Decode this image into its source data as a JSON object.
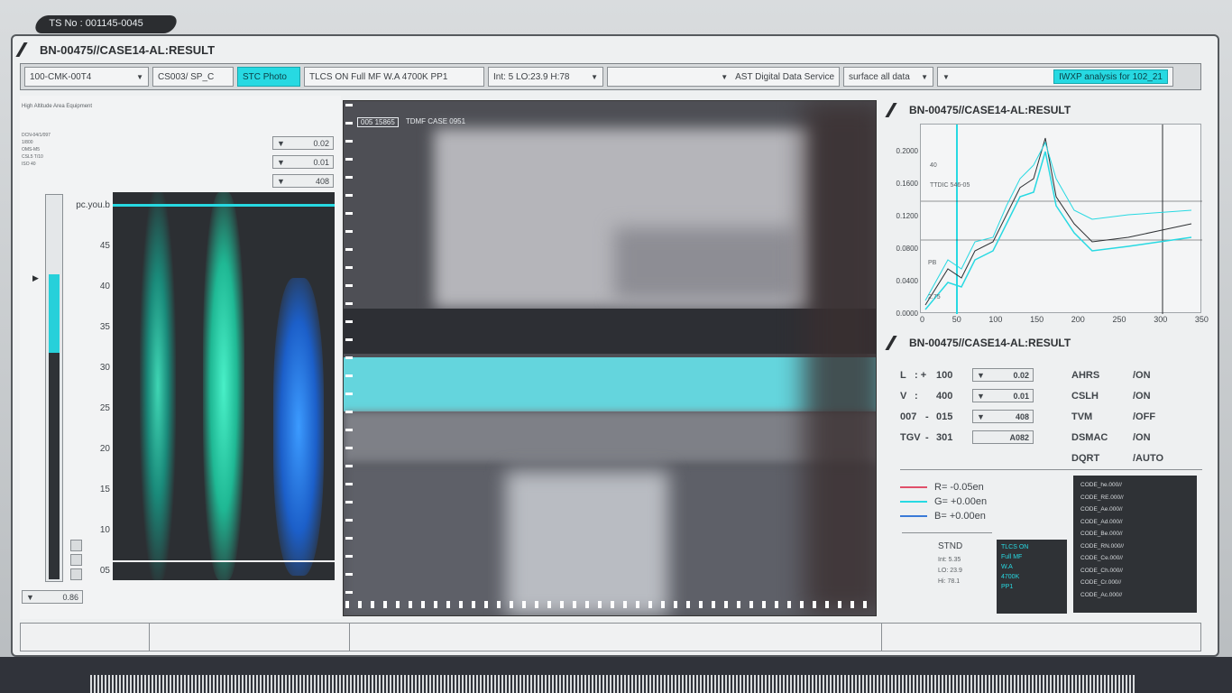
{
  "ts_no": "TS No : 001145-0045",
  "window_title": "BN-00475//CASE14-AL:RESULT",
  "toolbar": {
    "mode": "100-CMK-00T4",
    "code": "CS003/ SP_C",
    "photo_btn": "STC Photo",
    "tlcs": "TLCS ON  Full MF  W.A 4700K PP1",
    "int": "Int: 5 LO:23.9 H:78",
    "blank": "",
    "service": "AST Digital Data Service",
    "surface": "surface all data",
    "blank2": "",
    "analysis": "IWXP analysis for 102_21"
  },
  "left": {
    "header": "High Altitude Area Equipment",
    "info_lines": [
      "DCN-04/1/097",
      "1/800",
      "OMS-M5",
      "CSL5 T/10",
      "ISO 40"
    ],
    "values": [
      "0.02",
      "0.01",
      "408"
    ],
    "y_label": "pc.you.b",
    "y_ticks": [
      "45",
      "40",
      "35",
      "30",
      "25",
      "20",
      "15",
      "10",
      "05"
    ],
    "bottom_value": "0.86"
  },
  "video": {
    "tags": [
      "005 15865",
      "TDMF CASE 0951"
    ]
  },
  "graph": {
    "title": "BN-00475//CASE14-AL:RESULT",
    "y_ticks": [
      "0.2000",
      "0.1600",
      "0.1200",
      "0.0800",
      "0.0400",
      "0.0000"
    ],
    "x_ticks": [
      "0",
      "50",
      "100",
      "150",
      "200",
      "250",
      "300",
      "350"
    ],
    "annot1": "40",
    "annot2": "TTDIC 546-05",
    "annot3": "PB",
    "annot4": "2.75"
  },
  "readout_title": "BN-00475//CASE14-AL:RESULT",
  "readouts": [
    {
      "k": "L",
      "sep": ": +",
      "v": "100",
      "box": "0.02"
    },
    {
      "k": "V",
      "sep": ":",
      "v": "400",
      "box": "0.01"
    },
    {
      "k": "007",
      "sep": "-",
      "v": "015",
      "box": "408"
    },
    {
      "k": "TGV",
      "sep": "-",
      "v": "301",
      "box": "A082"
    }
  ],
  "systems": [
    {
      "k": "AHRS",
      "v": "/ON"
    },
    {
      "k": "CSLH",
      "v": "/ON"
    },
    {
      "k": "TVM",
      "v": "/OFF"
    },
    {
      "k": "DSMAC",
      "v": "/ON"
    },
    {
      "k": "DQRT",
      "v": "/AUTO"
    }
  ],
  "legend": [
    {
      "label": "R=   -0.05en",
      "color": "#e0506a"
    },
    {
      "label": "G=  +0.00en",
      "color": "#27d9e2"
    },
    {
      "label": "B=  +0.00en",
      "color": "#3a7ad8"
    }
  ],
  "stnd": {
    "title": "STND",
    "lines": [
      "Int: 5.35",
      "LO: 23.9",
      "Hi: 78.1"
    ],
    "box": [
      "TLCS ON",
      "Full MF",
      "W.A",
      "4700K",
      "PP1"
    ]
  },
  "codes": [
    "CODE_he.000//",
    "CODE_RE.000//",
    "CODE_Ae.000//",
    "CODE_Ad.000//",
    "CODE_Be.000//",
    "CODE_RN.000//",
    "CODE_Ce.000//",
    "CODE_Ch.000//",
    "CODE_Cr.000//",
    "CODE_Ac.000//"
  ]
}
